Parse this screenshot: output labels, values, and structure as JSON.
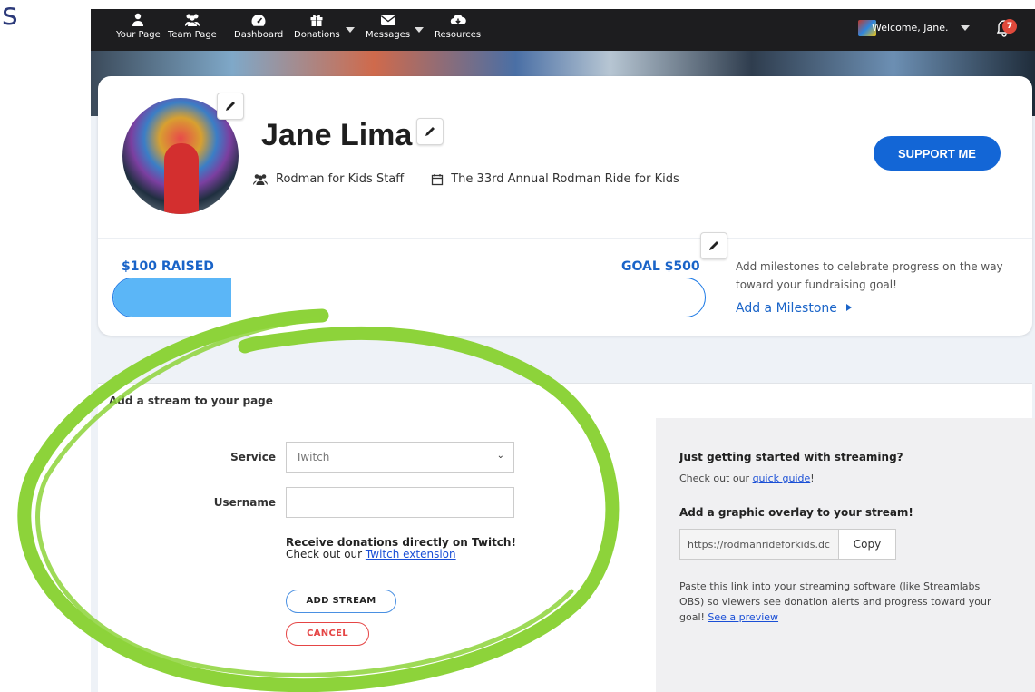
{
  "corner_letter": "s",
  "nav": {
    "items": [
      {
        "label": "Your Page",
        "icon": "person-icon"
      },
      {
        "label": "Team Page",
        "icon": "team-icon"
      },
      {
        "label": "Dashboard",
        "icon": "dashboard-icon"
      },
      {
        "label": "Donations",
        "icon": "gift-icon"
      },
      {
        "label": "Messages",
        "icon": "envelope-icon"
      },
      {
        "label": "Resources",
        "icon": "cloud-download-icon"
      }
    ],
    "welcome": "Welcome, Jane.",
    "notification_count": "7"
  },
  "profile": {
    "name": "Jane Lima",
    "team": "Rodman for Kids Staff",
    "event": "The 33rd Annual Rodman Ride for Kids",
    "support_label": "SUPPORT ME"
  },
  "progress": {
    "raised_label": "$100 RAISED",
    "goal_label": "GOAL $500",
    "fraction": 0.2,
    "milestone_text": "Add milestones to celebrate progress on the way toward your fundraising goal!",
    "milestone_link": "Add a Milestone"
  },
  "stream": {
    "header": "Add a stream to your page",
    "service_label": "Service",
    "service_value": "Twitch",
    "username_label": "Username",
    "username_value": "",
    "twitch_heading": "Receive donations directly on Twitch!",
    "twitch_prefix": "Check out our",
    "twitch_link": "Twitch extension",
    "add_label": "ADD STREAM",
    "cancel_label": "CANCEL"
  },
  "sidebar": {
    "getting_started_heading": "Just getting started with streaming?",
    "check_out_prefix": "Check out our",
    "quick_guide_link": "quick guide",
    "quick_guide_suffix": "!",
    "overlay_heading": "Add a graphic overlay to your stream!",
    "overlay_url": "https://rodmanrideforkids.dc",
    "copy_label": "Copy",
    "paste_text": "Paste this link into your streaming software (like Streamlabs OBS) so viewers see donation alerts and progress toward your goal!",
    "preview_link": "See a preview"
  },
  "colors": {
    "accent": "#1366d6",
    "progress_fill": "#5bb6f7",
    "cancel": "#e54545",
    "highlight": "#8dd33a"
  }
}
